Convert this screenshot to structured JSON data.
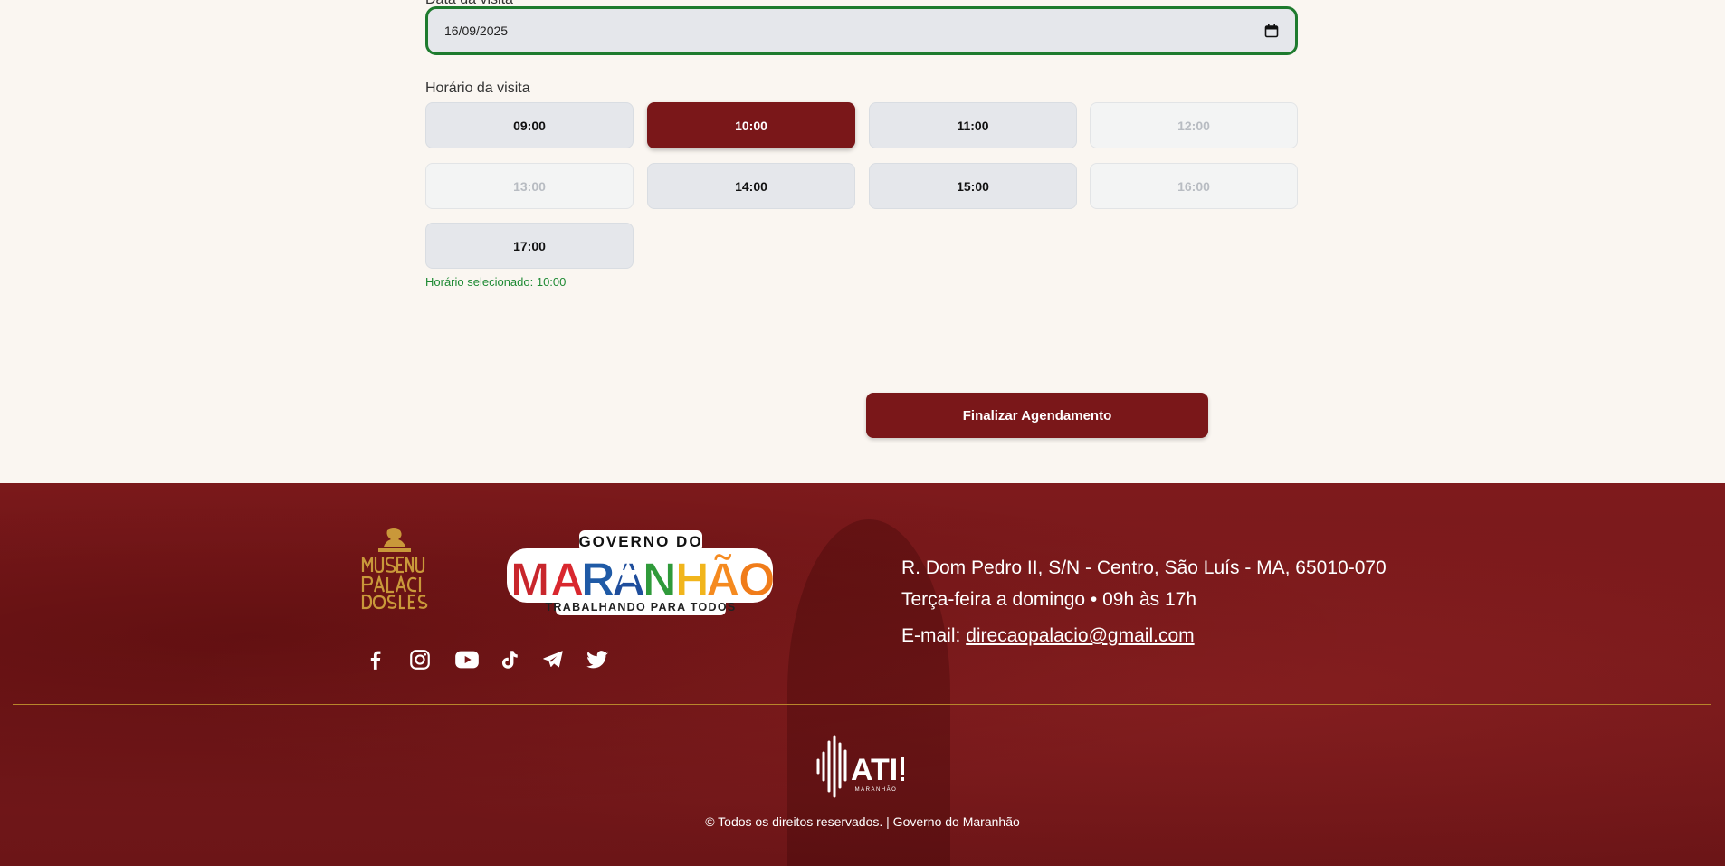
{
  "form": {
    "date_label": "Data da visita",
    "date_value": "16/09/2025",
    "time_label": "Horário da visita",
    "slots": [
      {
        "label": "09:00",
        "state": "available"
      },
      {
        "label": "10:00",
        "state": "selected"
      },
      {
        "label": "11:00",
        "state": "available"
      },
      {
        "label": "12:00",
        "state": "disabled"
      },
      {
        "label": "13:00",
        "state": "disabled"
      },
      {
        "label": "14:00",
        "state": "available"
      },
      {
        "label": "15:00",
        "state": "available"
      },
      {
        "label": "16:00",
        "state": "disabled"
      },
      {
        "label": "17:00",
        "state": "available"
      }
    ],
    "selected_note": "Horário selecionado: 10:00",
    "submit_label": "Finalizar Agendamento"
  },
  "footer": {
    "museum_logo_text": "MUSEU DO PALÁCIO DOS LEÕES",
    "gov_logo": {
      "top": "GOVERNO DO",
      "main": "MARANHÃO",
      "tagline": "TRABALHANDO PARA TODOS"
    },
    "socials": [
      "facebook-icon",
      "instagram-icon",
      "youtube-icon",
      "tiktok-icon",
      "telegram-icon",
      "twitter-icon"
    ],
    "address": "R. Dom Pedro II, S/N - Centro, São Luís - MA, 65010-070",
    "hours": "Terça-feira a domingo • 09h às 17h",
    "email_prefix": "E-mail: ",
    "email": "direcaopalacio@gmail.com",
    "ati_logo_text": "ATI MARANHÃO",
    "copyright": "© Todos os direitos reservados. | Governo do Maranhão"
  },
  "colors": {
    "brand_red": "#7a1719",
    "success_green": "#1e8a34",
    "slot_bg": "#e5e7eb",
    "page_bg": "#faf6f1"
  }
}
